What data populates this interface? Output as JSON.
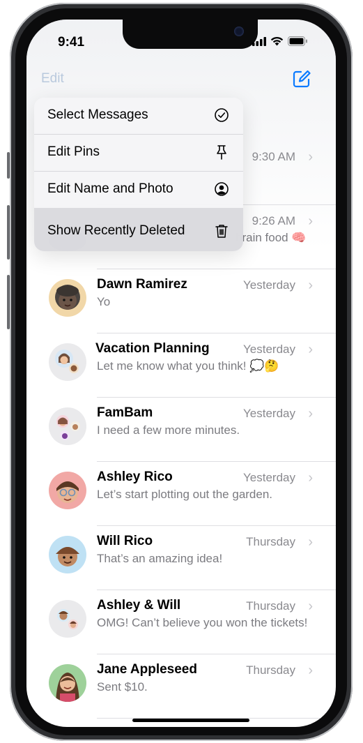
{
  "status_bar": {
    "time": "9:41"
  },
  "header": {
    "edit_label": "Edit",
    "compose_icon": "compose-icon"
  },
  "context_menu": {
    "items": [
      {
        "label": "Select Messages",
        "icon": "checkmark-circle-icon"
      },
      {
        "label": "Edit Pins",
        "icon": "pin-icon"
      },
      {
        "label": "Edit Name and Photo",
        "icon": "person-circle-icon"
      },
      {
        "label": "Show Recently Deleted",
        "icon": "trash-icon"
      }
    ]
  },
  "hidden_rows": [
    {
      "time": "9:30 AM"
    },
    {
      "time": "9:26 AM",
      "preview_fragment": "brain food 🧠"
    }
  ],
  "conversations": [
    {
      "name": "Dawn Ramirez",
      "preview": "Yo",
      "time": "Yesterday"
    },
    {
      "name": "Vacation Planning",
      "preview": "Let me know what you think! 💭🤔",
      "time": "Yesterday"
    },
    {
      "name": "FamBam",
      "preview": "I need a few more minutes.",
      "time": "Yesterday"
    },
    {
      "name": "Ashley Rico",
      "preview": "Let’s start plotting out the garden.",
      "time": "Yesterday"
    },
    {
      "name": "Will Rico",
      "preview": "That’s an amazing idea!",
      "time": "Thursday"
    },
    {
      "name": "Ashley & Will",
      "preview": "OMG! Can’t believe you won the tickets!",
      "time": "Thursday"
    },
    {
      "name": "Jane Appleseed",
      "preview": "Sent $10.",
      "time": "Thursday"
    }
  ],
  "colors": {
    "accent": "#0a7aff",
    "muted_accent": "#b9c9dd"
  }
}
